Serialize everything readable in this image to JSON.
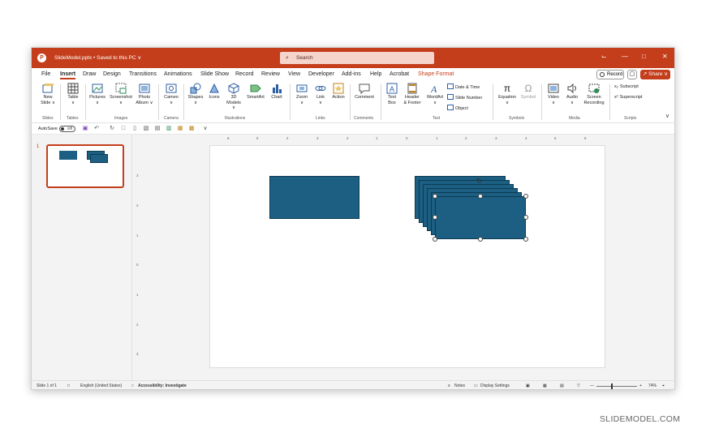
{
  "titlebar": {
    "doc_title": "SlideModel.pptx • Saved to this PC ∨",
    "search_placeholder": "Search",
    "controls": [
      "⌙",
      "—",
      "□",
      "✕"
    ]
  },
  "menubar": {
    "tabs": [
      "File",
      "Insert",
      "Draw",
      "Design",
      "Transitions",
      "Animations",
      "Slide Show",
      "Record",
      "Review",
      "View",
      "Developer",
      "Add-ins",
      "Help",
      "Acrobat",
      "Shape Format"
    ],
    "active_tab": "Insert",
    "record_label": "Record",
    "share_label": "↗ Share ∨"
  },
  "ribbon": {
    "buttons": [
      {
        "label": "New\nSlide ∨",
        "icon": "new-slide-icon"
      },
      {
        "label": "Table\n∨",
        "icon": "table-icon"
      },
      {
        "label": "Pictures\n∨",
        "icon": "pictures-icon"
      },
      {
        "label": "Screenshot\n∨",
        "icon": "screenshot-icon"
      },
      {
        "label": "Photo\nAlbum ∨",
        "icon": "photo-album-icon"
      },
      {
        "label": "Cameo\n∨",
        "icon": "cameo-icon"
      },
      {
        "label": "Shapes\n∨",
        "icon": "shapes-icon"
      },
      {
        "label": "Icons",
        "icon": "icons-icon"
      },
      {
        "label": "3D\nModels ∨",
        "icon": "3d-models-icon"
      },
      {
        "label": "SmartArt",
        "icon": "smartart-icon"
      },
      {
        "label": "Chart",
        "icon": "chart-icon"
      },
      {
        "label": "Zoom\n∨",
        "icon": "zoom-icon"
      },
      {
        "label": "Link\n∨",
        "icon": "link-icon"
      },
      {
        "label": "Action",
        "icon": "action-icon"
      },
      {
        "label": "Comment",
        "icon": "comment-icon"
      },
      {
        "label": "Text\nBox",
        "icon": "text-box-icon"
      },
      {
        "label": "Header\n& Footer",
        "icon": "header-footer-icon"
      },
      {
        "label": "WordArt\n∨",
        "icon": "wordart-icon"
      },
      {
        "label": "Equation\n∨",
        "icon": "equation-icon"
      },
      {
        "label": "Symbol",
        "icon": "symbol-icon"
      },
      {
        "label": "Video\n∨",
        "icon": "video-icon"
      },
      {
        "label": "Audio\n∨",
        "icon": "audio-icon"
      },
      {
        "label": "Screen\nRecording",
        "icon": "screen-recording-icon"
      }
    ],
    "small_buttons": [
      "Date & Time",
      "Slide Number",
      "Object",
      "Subscript",
      "Superscript"
    ],
    "groups": [
      "Slides",
      "Tables",
      "Images",
      "Camera",
      "Illustrations",
      "Links",
      "Comments",
      "Text",
      "Symbols",
      "Media",
      "Scripts"
    ]
  },
  "qat": {
    "autosave_label": "AutoSave",
    "autosave_state": "Off"
  },
  "thumbnails": {
    "slide_number": "1"
  },
  "ruler": {
    "top_ticks": [
      "6",
      "5",
      "4",
      "3",
      "2",
      "1",
      "0",
      "1",
      "2",
      "3",
      "4",
      "5",
      "6"
    ],
    "left_ticks": [
      "3",
      "2",
      "1",
      "0",
      "1",
      "2",
      "3"
    ]
  },
  "statusbar": {
    "slide_info": "Slide 1 of 1",
    "language": "English (United States)",
    "accessibility": "Accessibility: Investigate",
    "notes": "Notes",
    "display_settings": "Display Settings",
    "zoom_minus": "—",
    "zoom_plus": "+",
    "zoom_level": "74%"
  },
  "watermark": "SLIDEMODEL.COM",
  "colors": {
    "accent": "#c43e1c",
    "shape_fill": "#1c5f82"
  }
}
